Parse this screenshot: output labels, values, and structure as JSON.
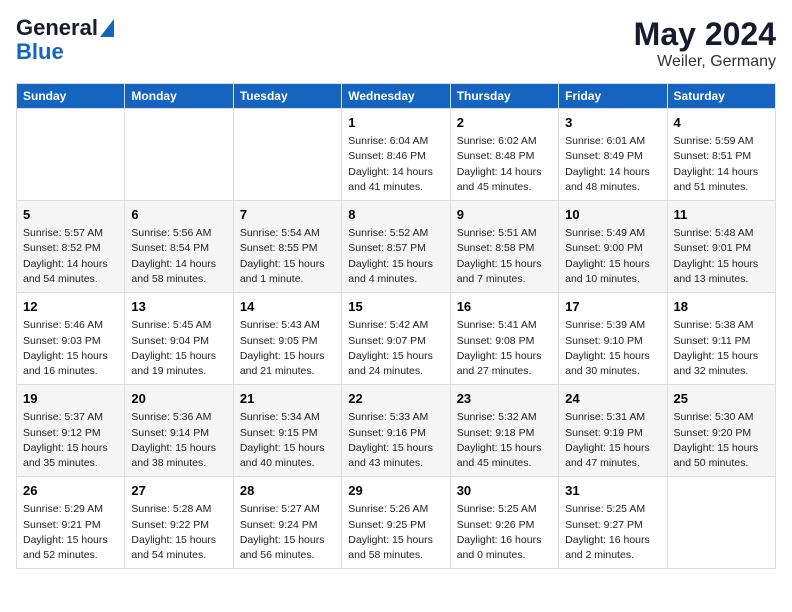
{
  "header": {
    "logo_line1": "General",
    "logo_line2": "Blue",
    "month_year": "May 2024",
    "location": "Weiler, Germany"
  },
  "days_of_week": [
    "Sunday",
    "Monday",
    "Tuesday",
    "Wednesday",
    "Thursday",
    "Friday",
    "Saturday"
  ],
  "weeks": [
    [
      {
        "day": "",
        "info": ""
      },
      {
        "day": "",
        "info": ""
      },
      {
        "day": "",
        "info": ""
      },
      {
        "day": "1",
        "info": "Sunrise: 6:04 AM\nSunset: 8:46 PM\nDaylight: 14 hours\nand 41 minutes."
      },
      {
        "day": "2",
        "info": "Sunrise: 6:02 AM\nSunset: 8:48 PM\nDaylight: 14 hours\nand 45 minutes."
      },
      {
        "day": "3",
        "info": "Sunrise: 6:01 AM\nSunset: 8:49 PM\nDaylight: 14 hours\nand 48 minutes."
      },
      {
        "day": "4",
        "info": "Sunrise: 5:59 AM\nSunset: 8:51 PM\nDaylight: 14 hours\nand 51 minutes."
      }
    ],
    [
      {
        "day": "5",
        "info": "Sunrise: 5:57 AM\nSunset: 8:52 PM\nDaylight: 14 hours\nand 54 minutes."
      },
      {
        "day": "6",
        "info": "Sunrise: 5:56 AM\nSunset: 8:54 PM\nDaylight: 14 hours\nand 58 minutes."
      },
      {
        "day": "7",
        "info": "Sunrise: 5:54 AM\nSunset: 8:55 PM\nDaylight: 15 hours\nand 1 minute."
      },
      {
        "day": "8",
        "info": "Sunrise: 5:52 AM\nSunset: 8:57 PM\nDaylight: 15 hours\nand 4 minutes."
      },
      {
        "day": "9",
        "info": "Sunrise: 5:51 AM\nSunset: 8:58 PM\nDaylight: 15 hours\nand 7 minutes."
      },
      {
        "day": "10",
        "info": "Sunrise: 5:49 AM\nSunset: 9:00 PM\nDaylight: 15 hours\nand 10 minutes."
      },
      {
        "day": "11",
        "info": "Sunrise: 5:48 AM\nSunset: 9:01 PM\nDaylight: 15 hours\nand 13 minutes."
      }
    ],
    [
      {
        "day": "12",
        "info": "Sunrise: 5:46 AM\nSunset: 9:03 PM\nDaylight: 15 hours\nand 16 minutes."
      },
      {
        "day": "13",
        "info": "Sunrise: 5:45 AM\nSunset: 9:04 PM\nDaylight: 15 hours\nand 19 minutes."
      },
      {
        "day": "14",
        "info": "Sunrise: 5:43 AM\nSunset: 9:05 PM\nDaylight: 15 hours\nand 21 minutes."
      },
      {
        "day": "15",
        "info": "Sunrise: 5:42 AM\nSunset: 9:07 PM\nDaylight: 15 hours\nand 24 minutes."
      },
      {
        "day": "16",
        "info": "Sunrise: 5:41 AM\nSunset: 9:08 PM\nDaylight: 15 hours\nand 27 minutes."
      },
      {
        "day": "17",
        "info": "Sunrise: 5:39 AM\nSunset: 9:10 PM\nDaylight: 15 hours\nand 30 minutes."
      },
      {
        "day": "18",
        "info": "Sunrise: 5:38 AM\nSunset: 9:11 PM\nDaylight: 15 hours\nand 32 minutes."
      }
    ],
    [
      {
        "day": "19",
        "info": "Sunrise: 5:37 AM\nSunset: 9:12 PM\nDaylight: 15 hours\nand 35 minutes."
      },
      {
        "day": "20",
        "info": "Sunrise: 5:36 AM\nSunset: 9:14 PM\nDaylight: 15 hours\nand 38 minutes."
      },
      {
        "day": "21",
        "info": "Sunrise: 5:34 AM\nSunset: 9:15 PM\nDaylight: 15 hours\nand 40 minutes."
      },
      {
        "day": "22",
        "info": "Sunrise: 5:33 AM\nSunset: 9:16 PM\nDaylight: 15 hours\nand 43 minutes."
      },
      {
        "day": "23",
        "info": "Sunrise: 5:32 AM\nSunset: 9:18 PM\nDaylight: 15 hours\nand 45 minutes."
      },
      {
        "day": "24",
        "info": "Sunrise: 5:31 AM\nSunset: 9:19 PM\nDaylight: 15 hours\nand 47 minutes."
      },
      {
        "day": "25",
        "info": "Sunrise: 5:30 AM\nSunset: 9:20 PM\nDaylight: 15 hours\nand 50 minutes."
      }
    ],
    [
      {
        "day": "26",
        "info": "Sunrise: 5:29 AM\nSunset: 9:21 PM\nDaylight: 15 hours\nand 52 minutes."
      },
      {
        "day": "27",
        "info": "Sunrise: 5:28 AM\nSunset: 9:22 PM\nDaylight: 15 hours\nand 54 minutes."
      },
      {
        "day": "28",
        "info": "Sunrise: 5:27 AM\nSunset: 9:24 PM\nDaylight: 15 hours\nand 56 minutes."
      },
      {
        "day": "29",
        "info": "Sunrise: 5:26 AM\nSunset: 9:25 PM\nDaylight: 15 hours\nand 58 minutes."
      },
      {
        "day": "30",
        "info": "Sunrise: 5:25 AM\nSunset: 9:26 PM\nDaylight: 16 hours\nand 0 minutes."
      },
      {
        "day": "31",
        "info": "Sunrise: 5:25 AM\nSunset: 9:27 PM\nDaylight: 16 hours\nand 2 minutes."
      },
      {
        "day": "",
        "info": ""
      }
    ]
  ]
}
